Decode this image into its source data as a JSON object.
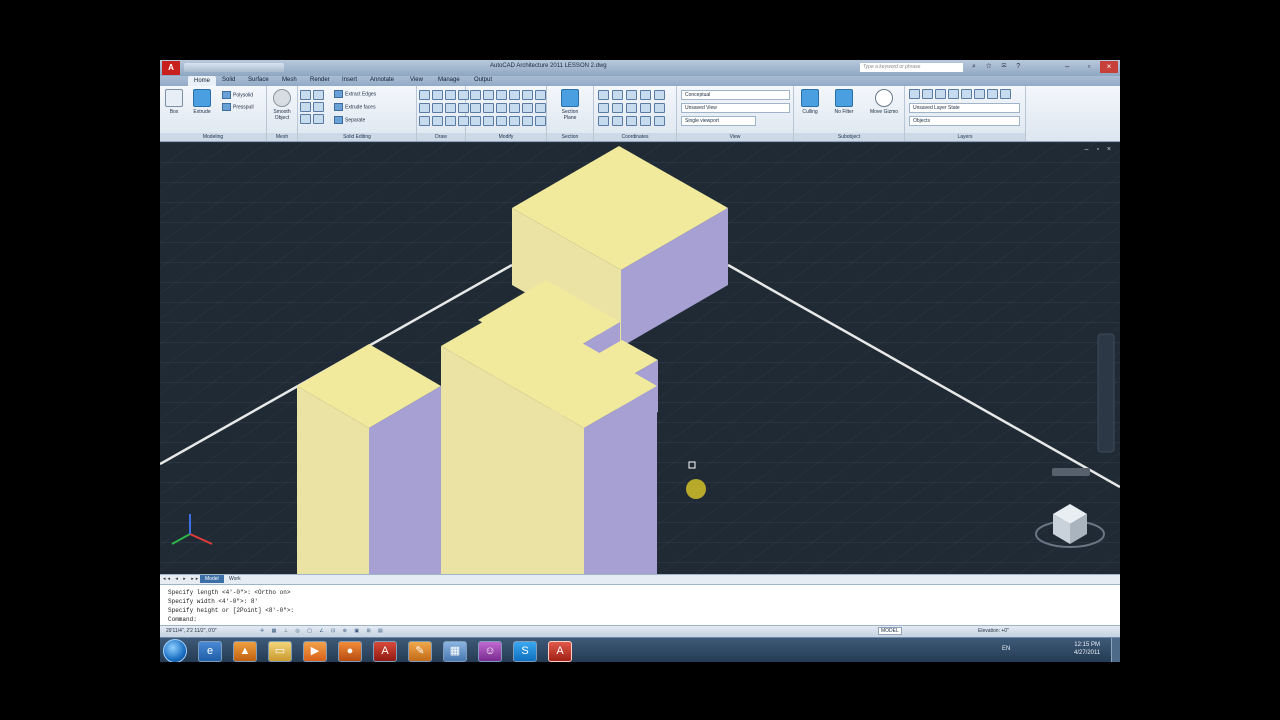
{
  "app": {
    "title": "AutoCAD Architecture 2011    LESSON 2.dwg",
    "search_placeholder": "Type a keyword or phrase",
    "menu_icon": "autocad-logo-icon",
    "logo_text": "A"
  },
  "tabs": [
    "Home",
    "Solid",
    "Surface",
    "Mesh",
    "Render",
    "Insert",
    "Annotate",
    "View",
    "Manage",
    "Output"
  ],
  "ribbon": {
    "modeling": {
      "title": "Modeling",
      "box": "Box",
      "extrude": "Extrude",
      "polysolid": "Polysolid",
      "presspull": "Presspull"
    },
    "mesh": {
      "title": "Mesh",
      "smooth_object_1": "Smooth",
      "smooth_object_2": "Object"
    },
    "solid_editing": {
      "title": "Solid Editing",
      "extract_edges": "Extract Edges",
      "extrude_faces": "Extrude faces",
      "separate": "Separate"
    },
    "draw": {
      "title": "Draw"
    },
    "modify": {
      "title": "Modify"
    },
    "section": {
      "title": "Section",
      "section_plane_1": "Section",
      "section_plane_2": "Plane"
    },
    "coordinates": {
      "title": "Coordinates"
    },
    "view": {
      "title": "View",
      "visual_style": "Conceptual",
      "saved_view": "Unsaved View",
      "viewport": "Single viewport"
    },
    "subobject": {
      "title": "Subobject",
      "culling": "Culling",
      "no_filter": "No Filter",
      "move_gizmo": "Move Gizmo"
    },
    "layers": {
      "title": "Layers",
      "layer_state": "Unsaved Layer State",
      "current_layer": "Objects"
    }
  },
  "layout_tabs": [
    "Model",
    "Work"
  ],
  "command_lines": [
    "Specify length <4'-0\">:  <Ortho on>",
    "Specify width <4'-0\">: 8'",
    "Specify height or [2Point] <8'-0\">:",
    "Command:"
  ],
  "status": {
    "coordinates": "29'11/4\", 2'2 11/2\", 0'0\"",
    "model_label": "MODEL",
    "elevation_label": "Elevation: +0\""
  },
  "taskbar": {
    "icons": [
      "ie-icon",
      "vlc-icon",
      "folder-icon",
      "media-player-icon",
      "firefox-icon",
      "autocad-icon",
      "paint-icon",
      "calculator-icon",
      "game-icon",
      "skype-icon",
      "autocad-active-icon"
    ],
    "lang": "EN",
    "time": "12:15 PM",
    "date": "4/27/2011"
  },
  "colors": {
    "viewport_bg": "#1f2a34",
    "box_top": "#f1ea9d",
    "box_left": "#ebe3a4",
    "box_right": "#a7a0d3",
    "grid": "#3b4755",
    "axis_line": "#e8e8e8"
  }
}
